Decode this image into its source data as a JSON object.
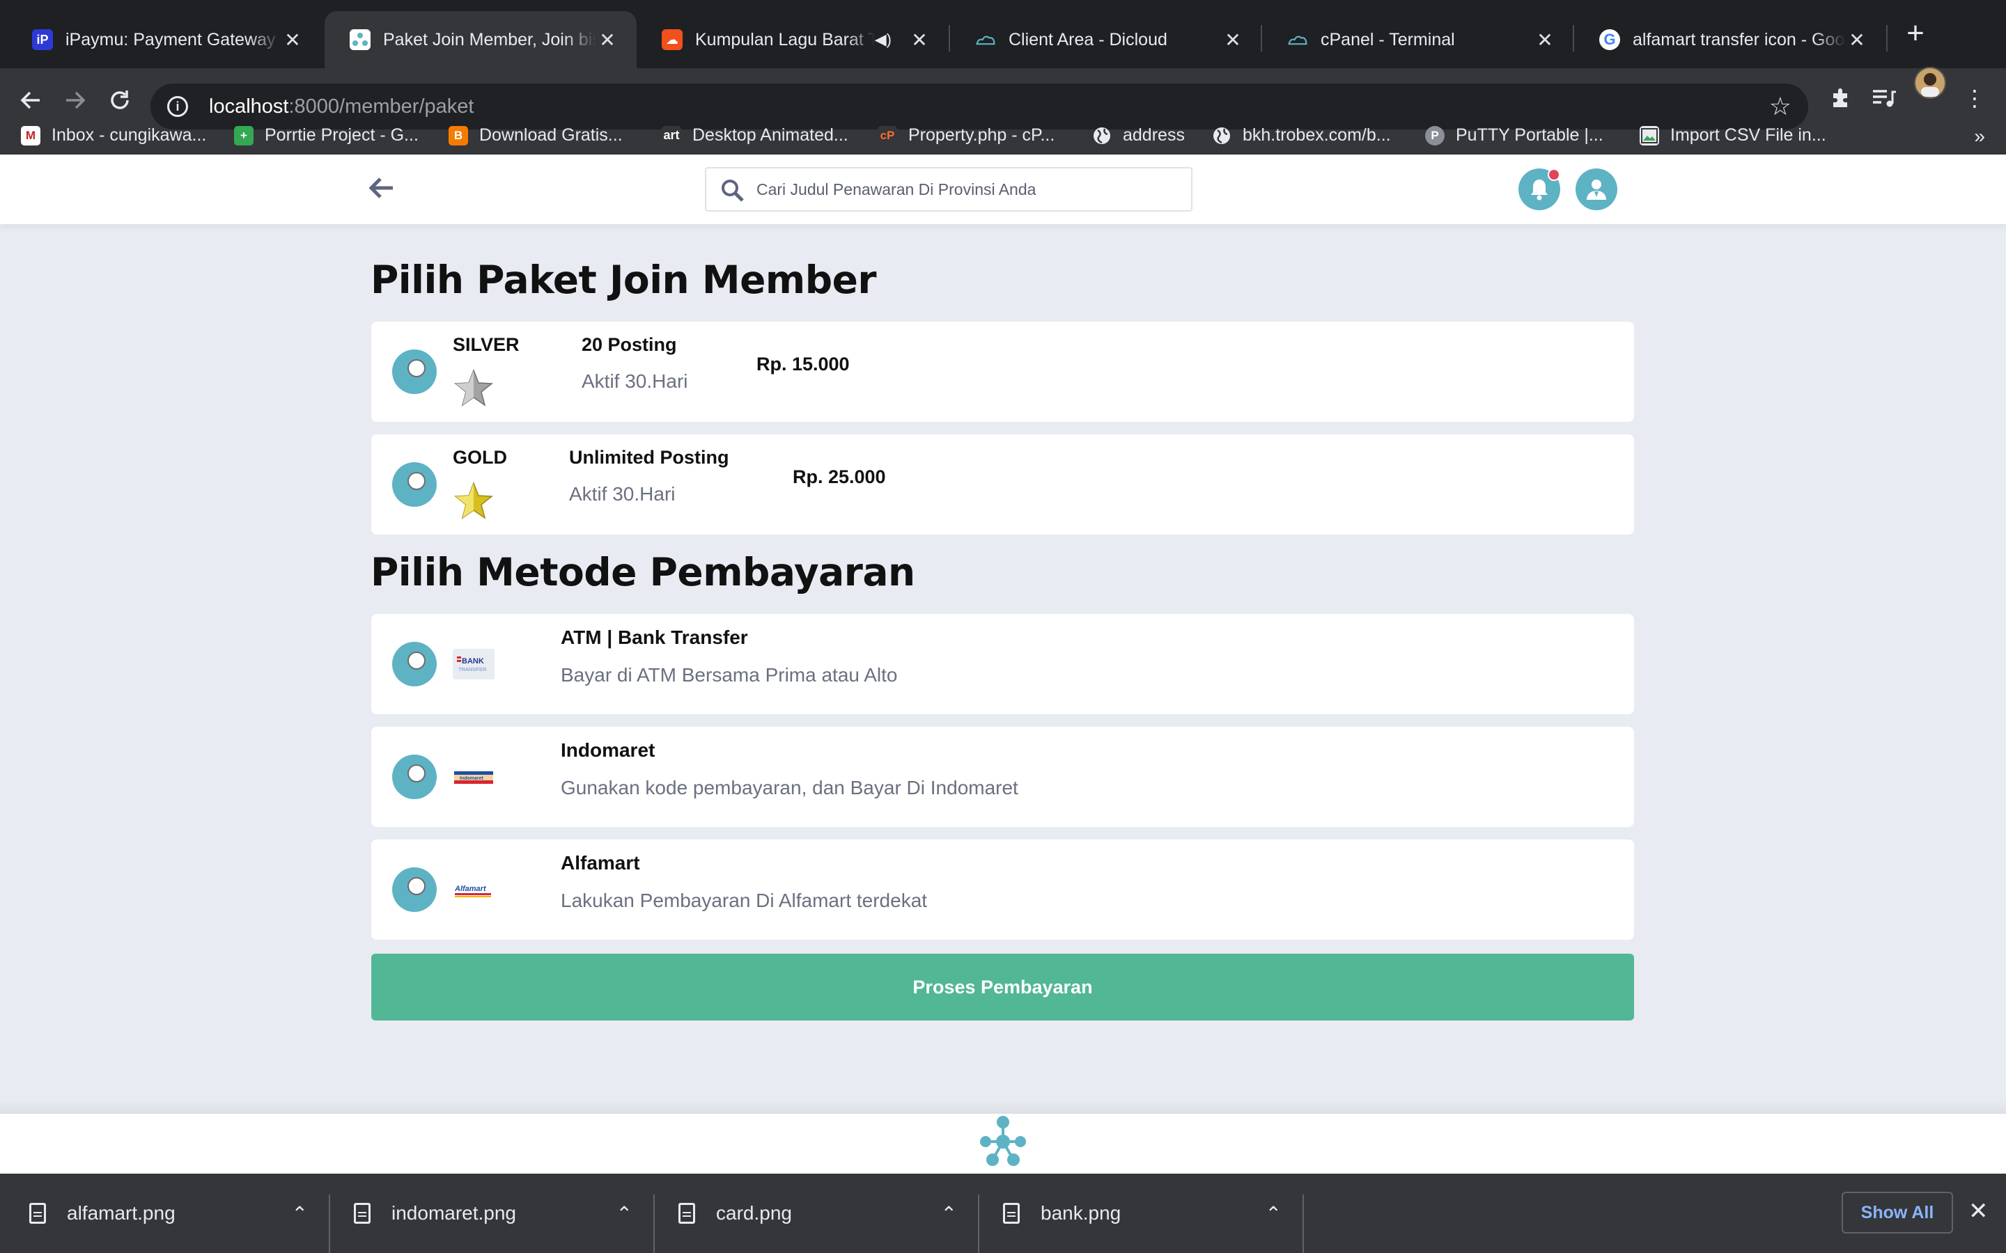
{
  "browser": {
    "tabs": [
      {
        "title": "iPaymu: Payment Gateway In",
        "favicon_color": "#2d3ad6",
        "favicon_text": "i"
      },
      {
        "title": "Paket Join Member, Join bis",
        "favicon_color": "#5db3c4",
        "favicon_text": "",
        "active": true
      },
      {
        "title": "Kumpulan Lagu Barat Te",
        "favicon_color": "#f2501c",
        "favicon_text": "☁",
        "audio": "🔊"
      },
      {
        "title": "Client Area - Dicloud",
        "favicon_color": "#35363a",
        "favicon_text": ""
      },
      {
        "title": "cPanel - Terminal",
        "favicon_color": "#35363a",
        "favicon_text": ""
      },
      {
        "title": "alfamart transfer icon - Goo",
        "favicon_color": "#ffffff",
        "favicon_text": "G"
      }
    ],
    "close_glyph": "✕",
    "new_tab": "+",
    "url_host": "localhost",
    "url_rest": ":8000/member/paket",
    "bookmarks": [
      {
        "label": "Inbox - cungikawa...",
        "color": "#c5221f",
        "icon": "M"
      },
      {
        "label": "Porrtie Project - G...",
        "color": "#34a853",
        "icon": "+"
      },
      {
        "label": "Download Gratis...",
        "color": "#f57c00",
        "icon": "B"
      },
      {
        "label": "Desktop Animated...",
        "color": "#333333",
        "icon": "art"
      },
      {
        "label": "Property.php - cP...",
        "color": "#ff6c2c",
        "icon": "cP"
      },
      {
        "label": "address",
        "color": "#e8eaed",
        "icon": "globe"
      },
      {
        "label": "bkh.trobex.com/b...",
        "color": "#e8eaed",
        "icon": "globe"
      },
      {
        "label": "PuTTY Portable |...",
        "color": "#8a8f98",
        "icon": "P"
      },
      {
        "label": "Import CSV File in...",
        "color": "#e8eaed",
        "icon": "img"
      }
    ],
    "bookmarks_more": "»"
  },
  "header": {
    "search_placeholder": "Cari Judul Penawaran Di Provinsi Anda",
    "accent": "#5db3c4",
    "notif_dot_color": "#e2445c"
  },
  "packages": {
    "title": "Pilih Paket Join Member",
    "items": [
      {
        "name": "SILVER",
        "posts": "20 Posting",
        "active": "Aktif 30.Hari",
        "price": "Rp. 15.000",
        "star": "silver-star-icon",
        "star_color": "#9a9a9a"
      },
      {
        "name": "GOLD",
        "posts": "Unlimited Posting",
        "active": "Aktif 30.Hari",
        "price": "Rp. 25.000",
        "star": "gold-star-icon",
        "star_color": "#e0c92b"
      }
    ]
  },
  "payment": {
    "title": "Pilih Metode Pembayaran",
    "methods": [
      {
        "name": "ATM | Bank Transfer",
        "desc": "Bayar di ATM Bersama Prima atau Alto",
        "logo": "bank-transfer-logo",
        "logo_text": "BANK TRANSFER"
      },
      {
        "name": "Indomaret",
        "desc": "Gunakan kode pembayaran, dan Bayar Di Indomaret",
        "logo": "indomaret-logo",
        "logo_text": "Indomaret"
      },
      {
        "name": "Alfamart",
        "desc": "Lakukan Pembayaran Di Alfamart terdekat",
        "logo": "alfamart-logo",
        "logo_text": "Alfamart"
      }
    ],
    "submit_label": "Proses Pembayaran",
    "submit_color": "#51b794"
  },
  "downloads": {
    "files": [
      "alfamart.png",
      "indomaret.png",
      "card.png",
      "bank.png"
    ],
    "chevron": "⌃",
    "show_all": "Show All",
    "close": "✕"
  }
}
